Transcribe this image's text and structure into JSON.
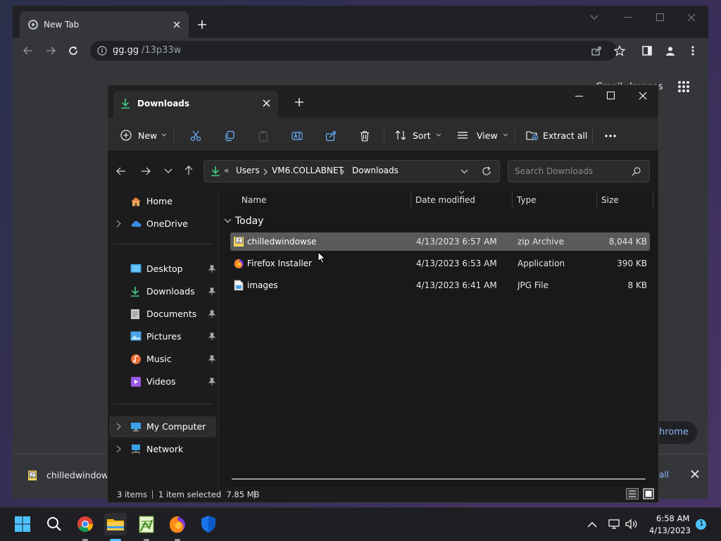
{
  "chrome": {
    "tab_title": "New Tab",
    "url_host": "gg.gg",
    "url_path": "/13p33w",
    "header_links": [
      "Gmail",
      "Images"
    ],
    "bg_button_partial": "hrome",
    "download_bar": {
      "file_name": "chilledwindows",
      "show_all_partial": "all"
    }
  },
  "explorer": {
    "tab_title": "Downloads",
    "commands": {
      "new": "New",
      "sort": "Sort",
      "view": "View",
      "extract_all": "Extract all"
    },
    "breadcrumb": [
      "Users",
      "VM6.COLLABNET",
      "Downloads"
    ],
    "search_placeholder": "Search Downloads",
    "nav": {
      "home": "Home",
      "onedrive": "OneDrive",
      "desktop": "Desktop",
      "downloads": "Downloads",
      "documents": "Documents",
      "pictures": "Pictures",
      "music": "Music",
      "videos": "Videos",
      "my_computer": "My Computer",
      "network": "Network"
    },
    "columns": {
      "name": "Name",
      "date": "Date modified",
      "type": "Type",
      "size": "Size"
    },
    "group_label": "Today",
    "files": [
      {
        "name": "chilledwindowse",
        "date": "4/13/2023 6:57 AM",
        "type": "zip Archive",
        "size": "8,044 KB",
        "selected": true
      },
      {
        "name": "Firefox Installer",
        "date": "4/13/2023 6:53 AM",
        "type": "Application",
        "size": "390 KB",
        "selected": false
      },
      {
        "name": "images",
        "date": "4/13/2023 6:41 AM",
        "type": "JPG File",
        "size": "8 KB",
        "selected": false
      }
    ],
    "status": {
      "count": "3 items",
      "selection": "1 item selected  7.85 MB"
    }
  },
  "taskbar": {
    "time": "6:58 AM",
    "date": "4/13/2023",
    "notification_count": "1"
  },
  "colors": {
    "accent_blue": "#4cc2ff",
    "selected_row": "#5a5a5a",
    "downloads_green": "#3fbf7f"
  }
}
